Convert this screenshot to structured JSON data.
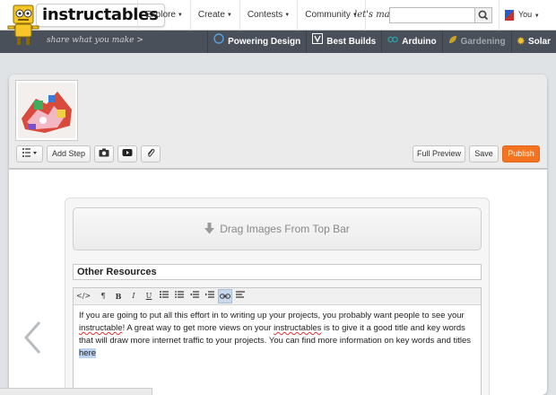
{
  "brand": {
    "name": "instructables",
    "robot_icon": "robot-mascot-icon"
  },
  "nav": {
    "items": [
      {
        "label": "Explore"
      },
      {
        "label": "Create"
      },
      {
        "label": "Contests"
      },
      {
        "label": "Community"
      }
    ],
    "lets_make": "let's make",
    "search_placeholder": "",
    "user_label": "You"
  },
  "channelbar": {
    "tagline": "share what you make  >",
    "channels": [
      {
        "label": "Powering Design",
        "icon": "dell-logo-icon"
      },
      {
        "label": "Best Builds",
        "icon": "v-logo-icon"
      },
      {
        "label": "Arduino",
        "icon": "arduino-icon"
      },
      {
        "label": "Gardening",
        "icon": "leaf-icon"
      },
      {
        "label": "Solar",
        "icon": "sun-icon"
      }
    ]
  },
  "editor": {
    "add_step_label": "Add Step",
    "full_preview_label": "Full Preview",
    "save_label": "Save",
    "publish_label": "Publish",
    "drop_label": "Drag Images From Top Bar",
    "step_title": "Other Resources",
    "body_part1": "If you are going to put all this effort in to writing up your projects, you probably want people to see your ",
    "body_spell1": "instructable",
    "body_part2": "! ",
    "body_part3": " A great way to get more views on your ",
    "body_spell2": "instructables",
    "body_part4": " is to give it a good title and key words that will draw more internet traffic to your projects.  You can find more information on key words and titles ",
    "body_link": "here",
    "rte_tools": [
      "</>",
      "¶",
      "B",
      "I",
      "U",
      "•≡",
      "1≡",
      "⇤≡",
      "≡⇥",
      "link",
      "≡"
    ]
  },
  "colors": {
    "accent": "#f37321",
    "channelbar": "#49505a",
    "selection": "#bcd2ee"
  }
}
